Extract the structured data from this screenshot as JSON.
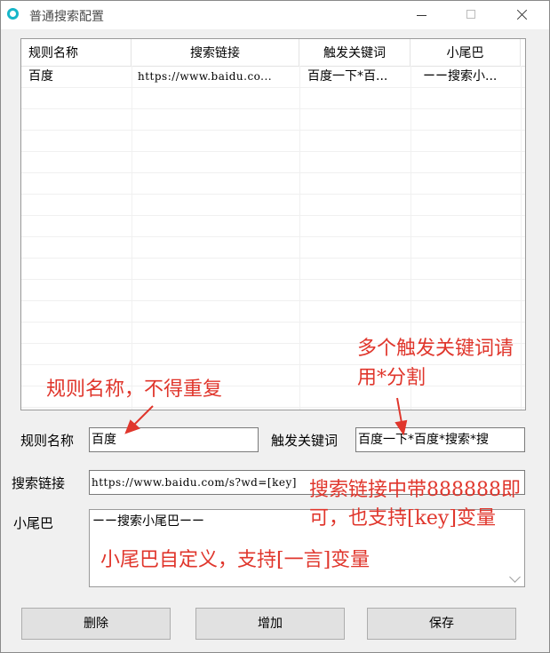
{
  "window": {
    "title": "普通搜索配置"
  },
  "table": {
    "columns": [
      "规则名称",
      "搜索链接",
      "触发关键词",
      "小尾巴"
    ],
    "rows": [
      {
        "name": "百度",
        "link": "https://www.baidu.co...",
        "keywords": "百度一下*百...",
        "tail": "ーー搜索小..."
      }
    ]
  },
  "form": {
    "rule_name_label": "规则名称",
    "rule_name_value": "百度",
    "keywords_label": "触发关键词",
    "keywords_value": "百度一下*百度*搜索*搜",
    "link_label": "搜索链接",
    "link_value": "https://www.baidu.com/s?wd=[key]",
    "tail_label": "小尾巴",
    "tail_value": "ーー搜索小尾巴ーー"
  },
  "buttons": {
    "delete": "删除",
    "add": "增加",
    "save": "保存"
  },
  "annotations": {
    "rule_name_note": "规则名称，不得重复",
    "keywords_note_line1": "多个触发关键词请",
    "keywords_note_line2": "用*分割",
    "link_note_line1": "搜索链接中带888888即",
    "link_note_line2": "可，也支持[key]变量",
    "tail_note": "小尾巴自定义，支持[一言]变量"
  },
  "colors": {
    "annotation": "#e0362c",
    "app_icon": "#17b6c9"
  }
}
